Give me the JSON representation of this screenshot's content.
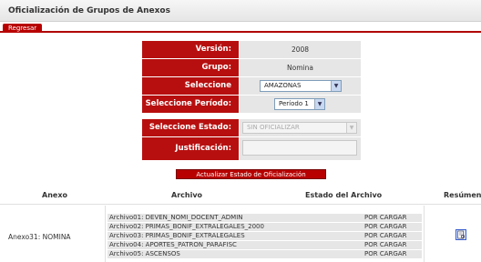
{
  "page": {
    "title": "Oficialización de Grupos de Anexos",
    "back_label": "Regresar"
  },
  "form": {
    "version_label": "Versión:",
    "version_value": "2008",
    "grupo_label": "Grupo:",
    "grupo_value": "Nomina",
    "secretaria_label": "Seleccione Secretaría:",
    "secretaria_value": "AMAZONAS",
    "periodo_label": "Seleccione Período:",
    "periodo_value": "Período 1",
    "estado_label": "Seleccione Estado:",
    "estado_value": "SIN OFICIALIZAR",
    "justificacion_label": "Justificación:",
    "justificacion_value": "",
    "update_button": "Actualizar Estado de Oficialización"
  },
  "table": {
    "headers": {
      "anexo": "Anexo",
      "archivo": "Archivo",
      "estado": "Estado del Archivo",
      "resumen": "Resúmen"
    },
    "anexo_name": "Anexo31: NOMINA",
    "rows": [
      {
        "archivo": "Archivo01: DEVEN_NOMI_DOCENT_ADMIN",
        "estado": "POR CARGAR"
      },
      {
        "archivo": "Archivo02: PRIMAS_BONIF_EXTRALEGALES_2000",
        "estado": "POR CARGAR"
      },
      {
        "archivo": "Archivo03: PRIMAS_BONIF_EXTRALEGALES",
        "estado": "POR CARGAR"
      },
      {
        "archivo": "Archivo04: APORTES_PATRON_PARAFISC",
        "estado": "POR CARGAR"
      },
      {
        "archivo": "Archivo05: ASCENSOS",
        "estado": "POR CARGAR"
      }
    ],
    "resumen_icon": "report-icon"
  },
  "colors": {
    "accent": "#b70f0f",
    "value_bg": "#e6e6e6"
  }
}
